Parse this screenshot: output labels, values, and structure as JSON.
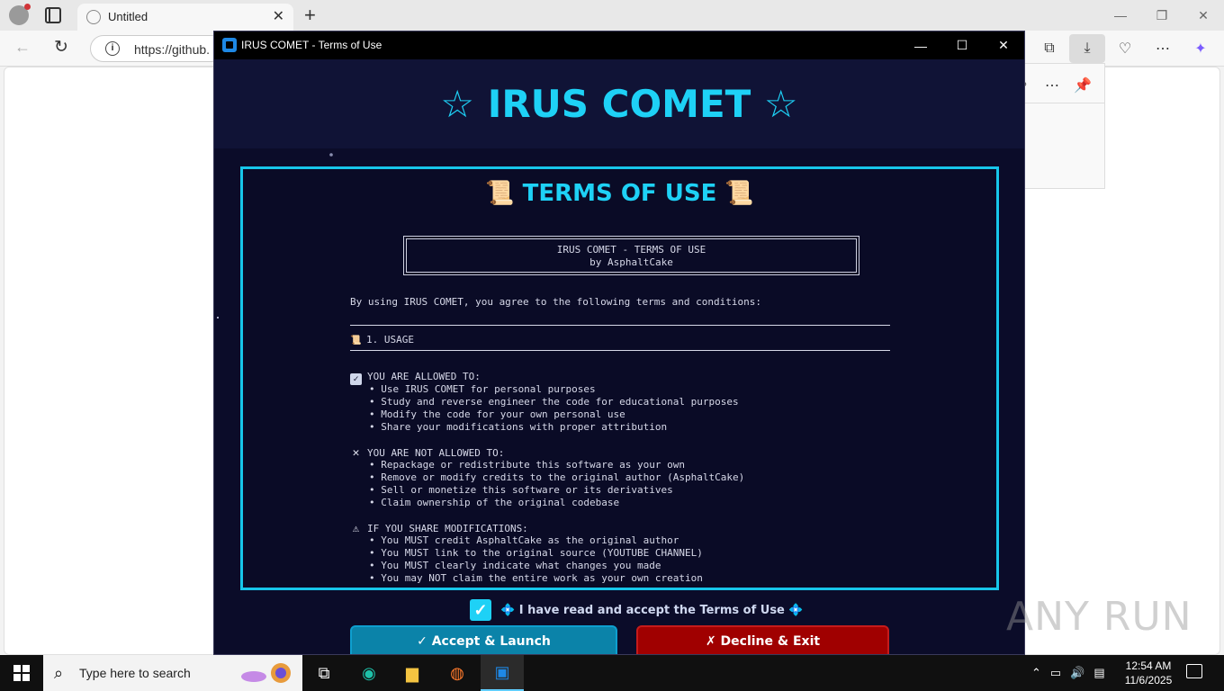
{
  "browser": {
    "tab_title": "Untitled",
    "url": "https://github.",
    "new_tab_symbol": "+",
    "close_symbol": "✕"
  },
  "app": {
    "window_title": "IRUS COMET - Terms of Use",
    "header_title": "☆ IRUS COMET ☆",
    "terms_heading": "📜 TERMS OF USE 📜",
    "banner_line1": "IRUS COMET - TERMS OF USE",
    "banner_line2": "by AsphaltCake",
    "intro": "By using IRUS COMET, you agree to the following terms and conditions:",
    "section1_title": "1. USAGE",
    "allowed_title": "YOU ARE ALLOWED TO:",
    "allowed_items": [
      "• Use IRUS COMET for personal purposes",
      "• Study and reverse engineer the code for educational purposes",
      "• Modify the code for your own personal use",
      "• Share your modifications with proper attribution"
    ],
    "not_allowed_title": "YOU ARE NOT ALLOWED TO:",
    "not_allowed_items": [
      "• Repackage or redistribute this software as your own",
      "• Remove or modify credits to the original author (AsphaltCake)",
      "• Sell or monetize this software or its derivatives",
      "• Claim ownership of the original codebase"
    ],
    "share_title": "IF YOU SHARE MODIFICATIONS:",
    "share_items": [
      "• You MUST credit AsphaltCake as the original author",
      "• You MUST link to the original source (YOUTUBE CHANNEL)",
      "• You MUST clearly indicate what changes you made",
      "• You may NOT claim the entire work as your own creation"
    ],
    "accept_checkbox_label": "💠 I have read and accept the Terms of Use 💠",
    "accept_checked": true,
    "accept_button": "✓ Accept & Launch",
    "decline_button": "✗ Decline & Exit",
    "colors": {
      "accent": "#1ed1f6",
      "background": "#0b0c29",
      "accept_button": "#0b83a9",
      "decline_button": "#a00000"
    }
  },
  "watermark": "ANY RUN",
  "taskbar": {
    "search_placeholder": "Type here to search",
    "time": "12:54 AM",
    "date": "11/6/2025"
  }
}
